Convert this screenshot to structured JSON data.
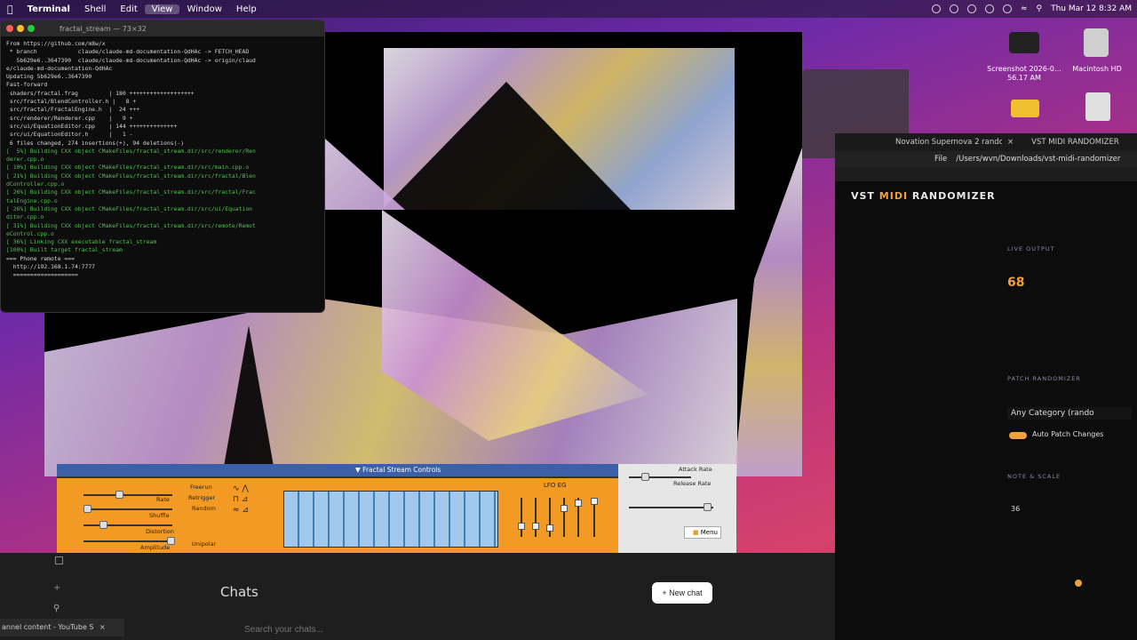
{
  "menubar": {
    "app": "Terminal",
    "items": [
      "Shell",
      "Edit",
      "View",
      "Window",
      "Help"
    ],
    "clock": "Thu Mar 12 8:32 AM"
  },
  "desktop": {
    "screenshot_label": "Screenshot 2026-0…56.17 AM",
    "hd_label": "Macintosh HD"
  },
  "terminal": {
    "title": "fractal_stream — 73×32",
    "lines": [
      "From https://github.com/m8w/x",
      " * branch            claude/claude-md-documentation-QdHAc -> FETCH_HEAD",
      "   5b629e6..3647390  claude/claude-md-documentation-QdHAc -> origin/claud",
      "e/claude-md-documentation-QdHAc",
      "Updating 5b629e6..3647390",
      "Fast-forward",
      " shaders/fractal.frag         | 180 +++++++++++++++++++",
      " src/fractal/BlendController.h |   8 +",
      " src/fractal/FractalEngine.h  |  24 +++",
      " src/renderer/Renderer.cpp    |   9 +",
      " src/ui/EquationEditor.cpp    | 144 ++++++++++++++",
      " src/ui/EquationEditor.h      |   1 -",
      " 6 files changed, 274 insertions(+), 94 deletions(-)",
      "[  5%] Building CXX object CMakeFiles/fractal_stream.dir/src/renderer/Ren",
      "derer.cpp.o",
      "[ 10%] Building CXX object CMakeFiles/fractal_stream.dir/src/main.cpp.o",
      "[ 21%] Building CXX object CMakeFiles/fractal_stream.dir/src/fractal/Blen",
      "dController.cpp.o",
      "[ 26%] Building CXX object CMakeFiles/fractal_stream.dir/src/fractal/Frac",
      "talEngine.cpp.o",
      "[ 26%] Building CXX object CMakeFiles/fractal_stream.dir/src/ui/Equation",
      "ditor.cpp.o",
      "[ 31%] Building CXX object CMakeFiles/fractal_stream.dir/src/remote/Remot",
      "eControl.cpp.o",
      "[ 36%] Linking CXX executable fractal_stream",
      "[100%] Built target fractal_stream",
      "",
      "=== Phone remote ===",
      "  http://192.168.1.74:7777",
      "  ==================="
    ]
  },
  "controls": {
    "title": "Fractal Stream Controls",
    "labels": {
      "rate": "Rate",
      "shuffle": "Shuffle",
      "distortion": "Distortion",
      "amplitude": "Amplitude",
      "freerun": "Freerun",
      "retrigger": "Retrigger",
      "random": "Random",
      "unipolar": "Unipolar",
      "lfo_eg": "LFO EG",
      "attack": "Attack Rate",
      "release": "Release Rate",
      "menu": "Menu"
    }
  },
  "chat": {
    "title": "Chats",
    "new_chat": "+ New chat",
    "search_placeholder": "Search your chats...",
    "youtube_tab": "annel content - YouTube S"
  },
  "browser": {
    "tab1": "Novation Supernova 2 rando",
    "tab2": "VST MIDI RANDOMIZER",
    "url_label": "File",
    "url": "/Users/wvn/Downloads/vst-midi-randomizer"
  },
  "vst": {
    "title_a": "VST ",
    "title_b": "MIDI",
    "title_c": " RANDOMIZER",
    "live_output": "LIVE OUTPUT",
    "live_value": "68",
    "patch_randomizer": "PATCH RANDOMIZER",
    "category": "Any Category (rando",
    "auto_patch": "Auto Patch Changes",
    "note_scale": "NOTE & SCALE",
    "note_value": "36"
  },
  "colors": {
    "accent_orange": "#f29a23",
    "controls_title_bar": "#3b5fa8",
    "vst_accent": "#f0a040"
  }
}
